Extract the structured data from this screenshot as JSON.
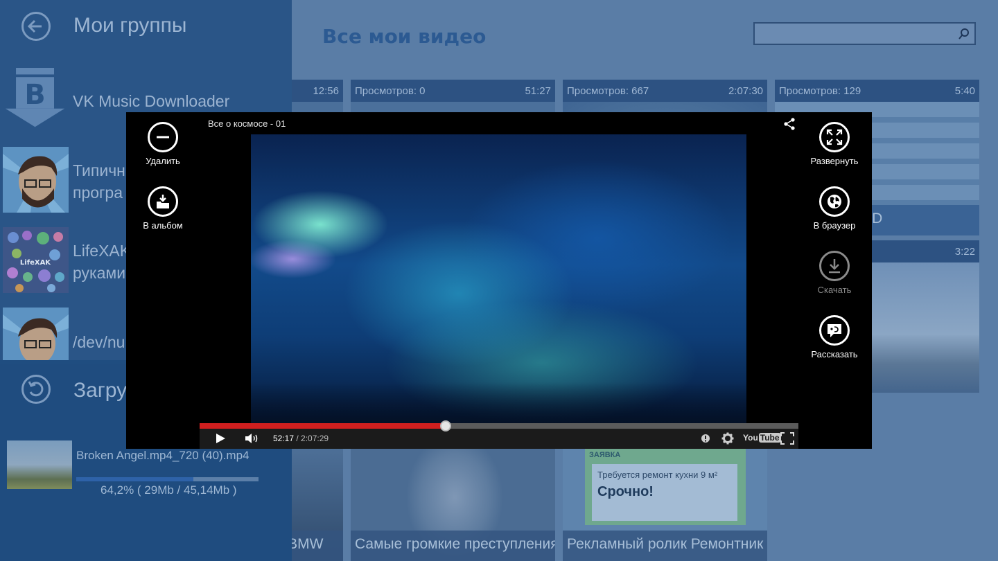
{
  "main": {
    "title": "Все мои видео",
    "search": {
      "value": "",
      "placeholder": ""
    },
    "tiles": [
      {
        "views_label": "",
        "views": "",
        "duration": "12:56",
        "caption": ""
      },
      {
        "views_label": "Просмотров:",
        "views": "0",
        "duration": "51:27",
        "caption": ""
      },
      {
        "views_label": "Просмотров:",
        "views": "667",
        "duration": "2:07:30",
        "caption": ""
      },
      {
        "views_label": "Просмотров:",
        "views": "129",
        "duration": "5:40",
        "caption": "loader на WIND"
      },
      {
        "views_label": "",
        "views": "",
        "duration": "3:22",
        "caption": ""
      },
      {
        "views_label": "",
        "views": "",
        "duration": "",
        "caption": "на BMW"
      },
      {
        "views_label": "",
        "views": "",
        "duration": "",
        "caption": "Самые громкие преступления"
      },
      {
        "views_label": "",
        "views": "",
        "duration": "",
        "caption": "Рекламный ролик Ремонтник"
      }
    ],
    "ad_card": {
      "header": "ЗАЯВКА",
      "line1": "Требуется ремонт кухни 9 м²",
      "line2": "Срочно!"
    }
  },
  "sidebar": {
    "groups_title": "Мои группы",
    "groups": [
      {
        "name": "VK Music Downloader"
      },
      {
        "name": "Типичн\nпрогра"
      },
      {
        "name": "LifeXAK\nруками"
      },
      {
        "name": "/dev/nu"
      }
    ],
    "avatar_text": "LifeXAK",
    "downloads_title": "Загру",
    "download": {
      "name": "Broken Angel.mp4_720 (40).mp4",
      "progress": 0.642,
      "status": "64,2% ( 29Mb / 45,14Mb )"
    }
  },
  "player": {
    "title": "Все о космосе - 01",
    "actions_left": [
      {
        "label": "Удалить",
        "icon": "minus-icon"
      },
      {
        "label": "В альбом",
        "icon": "download-to-album-icon"
      }
    ],
    "actions_right": [
      {
        "label": "Развернуть",
        "icon": "expand-icon"
      },
      {
        "label": "В браузер",
        "icon": "globe-icon"
      },
      {
        "label": "Скачать",
        "icon": "download-icon",
        "disabled": true
      },
      {
        "label": "Рассказать",
        "icon": "share-chat-icon"
      }
    ],
    "controls": {
      "current_time": "52:17",
      "separator": " / ",
      "duration": "2:07:29",
      "progress": 0.411,
      "youtube_left": "You",
      "youtube_right": "Tube"
    }
  },
  "colors": {
    "accent_red": "#d01f1f",
    "sidebar": "#2a5587",
    "overlay_bg": "#5a7da6"
  }
}
